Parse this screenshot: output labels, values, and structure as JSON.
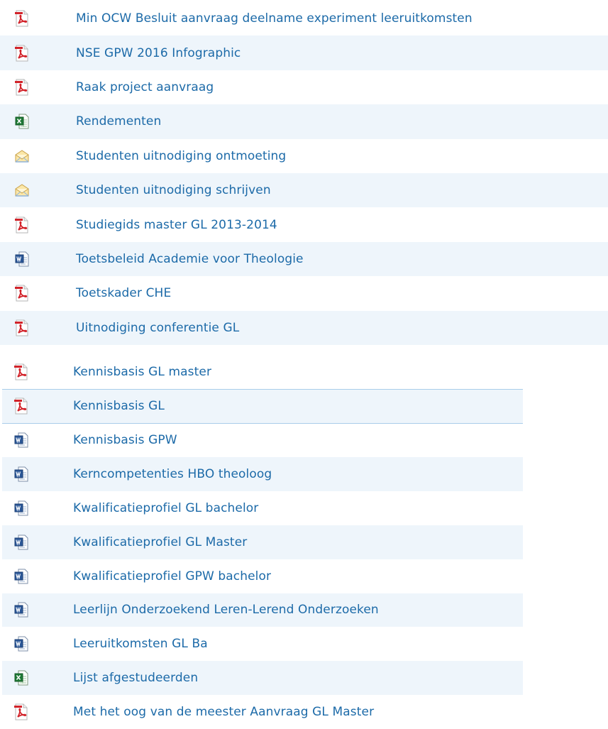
{
  "colors": {
    "link": "#1c6aa8",
    "alt_row": "#eef5fb",
    "separator": "#a9cdea"
  },
  "list1": [
    {
      "icon": "pdf-icon",
      "label": "Min OCW Besluit aanvraag deelname experiment leeruitkomsten"
    },
    {
      "icon": "pdf-icon",
      "label": "NSE GPW 2016 Infographic"
    },
    {
      "icon": "pdf-icon",
      "label": "Raak project aanvraag"
    },
    {
      "icon": "excel-icon",
      "label": "Rendementen"
    },
    {
      "icon": "email-icon",
      "label": "Studenten uitnodiging ontmoeting"
    },
    {
      "icon": "email-icon",
      "label": "Studenten uitnodiging schrijven"
    },
    {
      "icon": "pdf-icon",
      "label": "Studiegids master GL 2013-2014"
    },
    {
      "icon": "word-icon",
      "label": "Toetsbeleid Academie voor Theologie"
    },
    {
      "icon": "pdf-icon",
      "label": "Toetskader CHE"
    },
    {
      "icon": "pdf-icon",
      "label": "Uitnodiging conferentie GL"
    }
  ],
  "list2": [
    {
      "icon": "pdf-icon",
      "label": "Kennisbasis GL master"
    },
    {
      "icon": "pdf-icon",
      "label": "Kennisbasis GL"
    },
    {
      "icon": "word-icon",
      "label": "Kennisbasis GPW"
    },
    {
      "icon": "word-icon",
      "label": "Kerncompetenties HBO theoloog"
    },
    {
      "icon": "word-icon",
      "label": "Kwalificatieprofiel GL bachelor"
    },
    {
      "icon": "word-icon",
      "label": "Kwalificatieprofiel GL Master"
    },
    {
      "icon": "word-icon",
      "label": "Kwalificatieprofiel GPW bachelor"
    },
    {
      "icon": "word-icon",
      "label": "Leerlijn Onderzoekend Leren-Lerend Onderzoeken"
    },
    {
      "icon": "word-icon",
      "label": "Leeruitkomsten GL Ba"
    },
    {
      "icon": "excel-icon",
      "label": "Lijst afgestudeerden"
    },
    {
      "icon": "pdf-icon",
      "label": "Met het oog van de meester Aanvraag GL Master"
    }
  ]
}
